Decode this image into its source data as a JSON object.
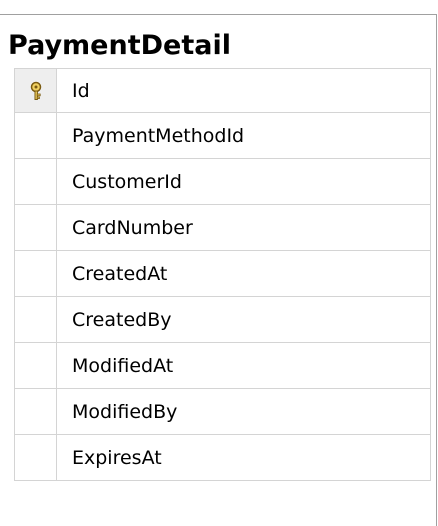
{
  "table": {
    "name": "PaymentDetail",
    "columns": [
      {
        "name": "Id",
        "primary_key": true,
        "icon": "key-icon"
      },
      {
        "name": "PaymentMethodId",
        "primary_key": false
      },
      {
        "name": "CustomerId",
        "primary_key": false
      },
      {
        "name": "CardNumber",
        "primary_key": false
      },
      {
        "name": "CreatedAt",
        "primary_key": false
      },
      {
        "name": "CreatedBy",
        "primary_key": false
      },
      {
        "name": "ModifiedAt",
        "primary_key": false
      },
      {
        "name": "ModifiedBy",
        "primary_key": false
      },
      {
        "name": "ExpiresAt",
        "primary_key": false
      }
    ]
  },
  "colors": {
    "key_fill": "#f0d060",
    "key_stroke": "#7a5a10",
    "border": "#d4d4d4",
    "outer_border": "#a0a0a0"
  }
}
